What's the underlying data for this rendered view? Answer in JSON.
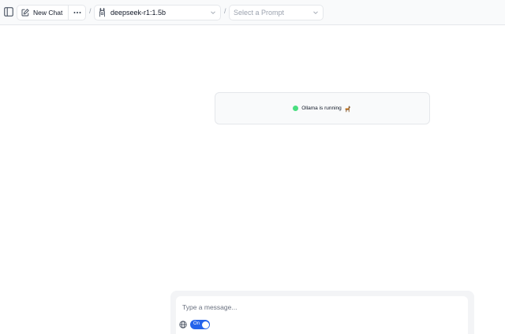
{
  "toolbar": {
    "sidebar_toggle_icon": "sidebar-panel-icon",
    "new_chat_label": "New Chat",
    "new_chat_icon": "edit-icon",
    "more_icon": "more-horizontal-icon",
    "separator": "/",
    "model": {
      "icon": "ollama-icon",
      "selected": "deepseek-r1:1.5b"
    },
    "prompt": {
      "placeholder": "Select a Prompt"
    }
  },
  "status": {
    "text": "Ollama is running",
    "indicator_color": "#4ade80",
    "emoji_icon": "llama-icon"
  },
  "composer": {
    "placeholder": "Type a message...",
    "web_icon": "globe-icon",
    "toggle_label": "On",
    "toggle_on": true,
    "accent_color": "#2563eb"
  }
}
